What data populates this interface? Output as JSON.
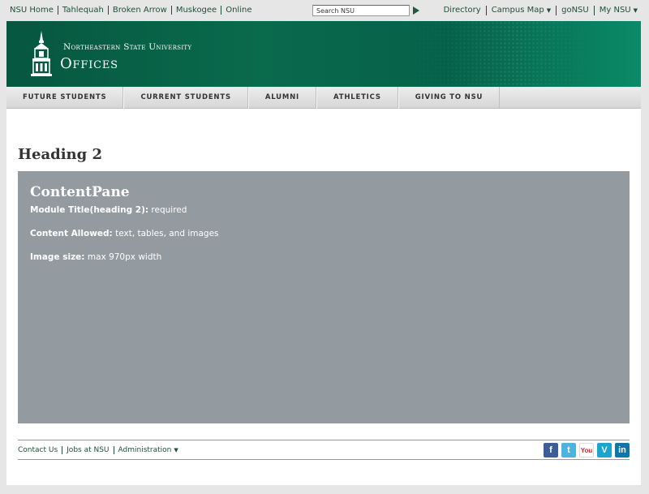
{
  "topbar": {
    "links": [
      "NSU Home",
      "Tahlequah",
      "Broken Arrow",
      "Muskogee",
      "Online"
    ],
    "search_placeholder": "Search NSU",
    "right_links": [
      {
        "label": "Directory",
        "caret": ""
      },
      {
        "label": "Campus Map",
        "caret": "▼"
      },
      {
        "label": "goNSU",
        "caret": ""
      },
      {
        "label": "My NSU",
        "caret": "▼"
      }
    ]
  },
  "banner": {
    "university": "Northeastern State University",
    "site": "Offices"
  },
  "nav": [
    "FUTURE STUDENTS",
    "CURRENT STUDENTS",
    "ALUMNI",
    "ATHLETICS",
    "GIVING TO NSU"
  ],
  "main": {
    "heading": "Heading 2",
    "pane": {
      "title": "ContentPane",
      "rows": [
        {
          "label": "Module Title(heading 2):",
          "value": "required"
        },
        {
          "label": "Content Allowed:",
          "value": "text, tables, and images"
        },
        {
          "label": "Image size:",
          "value": "max 970px width"
        }
      ]
    }
  },
  "footer": {
    "links": [
      "Contact Us",
      "Jobs at NSU",
      "Administration"
    ],
    "admin_caret": "▼",
    "social": [
      {
        "name": "facebook-icon",
        "glyph": "f"
      },
      {
        "name": "twitter-icon",
        "glyph": "t"
      },
      {
        "name": "youtube-icon",
        "glyph": "You"
      },
      {
        "name": "vimeo-icon",
        "glyph": "V"
      },
      {
        "name": "linkedin-icon",
        "glyph": "in"
      }
    ]
  }
}
